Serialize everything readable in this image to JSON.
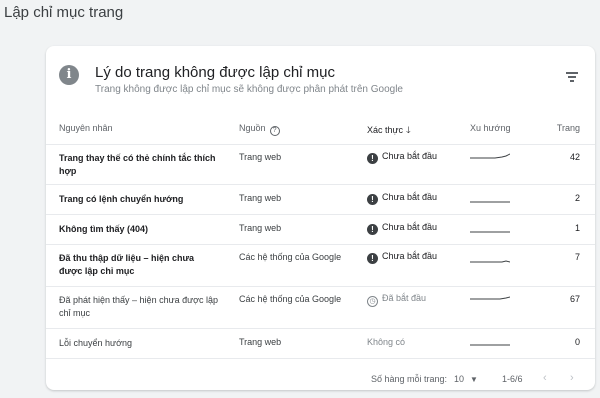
{
  "page": {
    "title": "Lập chỉ mục trang"
  },
  "card": {
    "title": "Lý do trang không được lập chỉ mục",
    "subtitle": "Trang không được lập chỉ mục sẽ không được phân phát trên Google"
  },
  "table": {
    "headers": {
      "reason": "Nguyên nhân",
      "source": "Nguồn",
      "validation": "Xác thực",
      "trend": "Xu hướng",
      "pages": "Trang"
    },
    "rows": [
      {
        "reason": "Trang thay thế có thẻ chính tắc thích hợp",
        "source": "Trang web",
        "status": "Chưa bắt đầu",
        "status_icon": "alert-icon",
        "pages": "42"
      },
      {
        "reason": "Trang có lệnh chuyển hướng",
        "source": "Trang web",
        "status": "Chưa bắt đầu",
        "status_icon": "alert-icon",
        "pages": "2"
      },
      {
        "reason": "Không tìm thấy (404)",
        "source": "Trang web",
        "status": "Chưa bắt đầu",
        "status_icon": "alert-icon",
        "pages": "1"
      },
      {
        "reason": "Đã thu thập dữ liệu – hiện chưa được lập chỉ mục",
        "source": "Các hệ thống của Google",
        "status": "Chưa bắt đầu",
        "status_icon": "alert-icon",
        "pages": "7"
      },
      {
        "reason": "Đã phát hiện thấy – hiện chưa được lập chỉ mục",
        "source": "Các hệ thống của Google",
        "status": "Đã bắt đầu",
        "status_icon": "clock-icon",
        "pages": "67"
      },
      {
        "reason": "Lỗi chuyển hướng",
        "source": "Trang web",
        "status": "Không có",
        "status_icon": "",
        "pages": "0"
      }
    ]
  },
  "footer": {
    "rows_per_page_label": "Số hàng mỗi trang:",
    "rows_per_page_value": "10",
    "range": "1-6/6"
  },
  "colors": {
    "text": "#202124",
    "muted": "#80868b",
    "divider": "#e8eaed",
    "background": "#f1f3f4"
  }
}
